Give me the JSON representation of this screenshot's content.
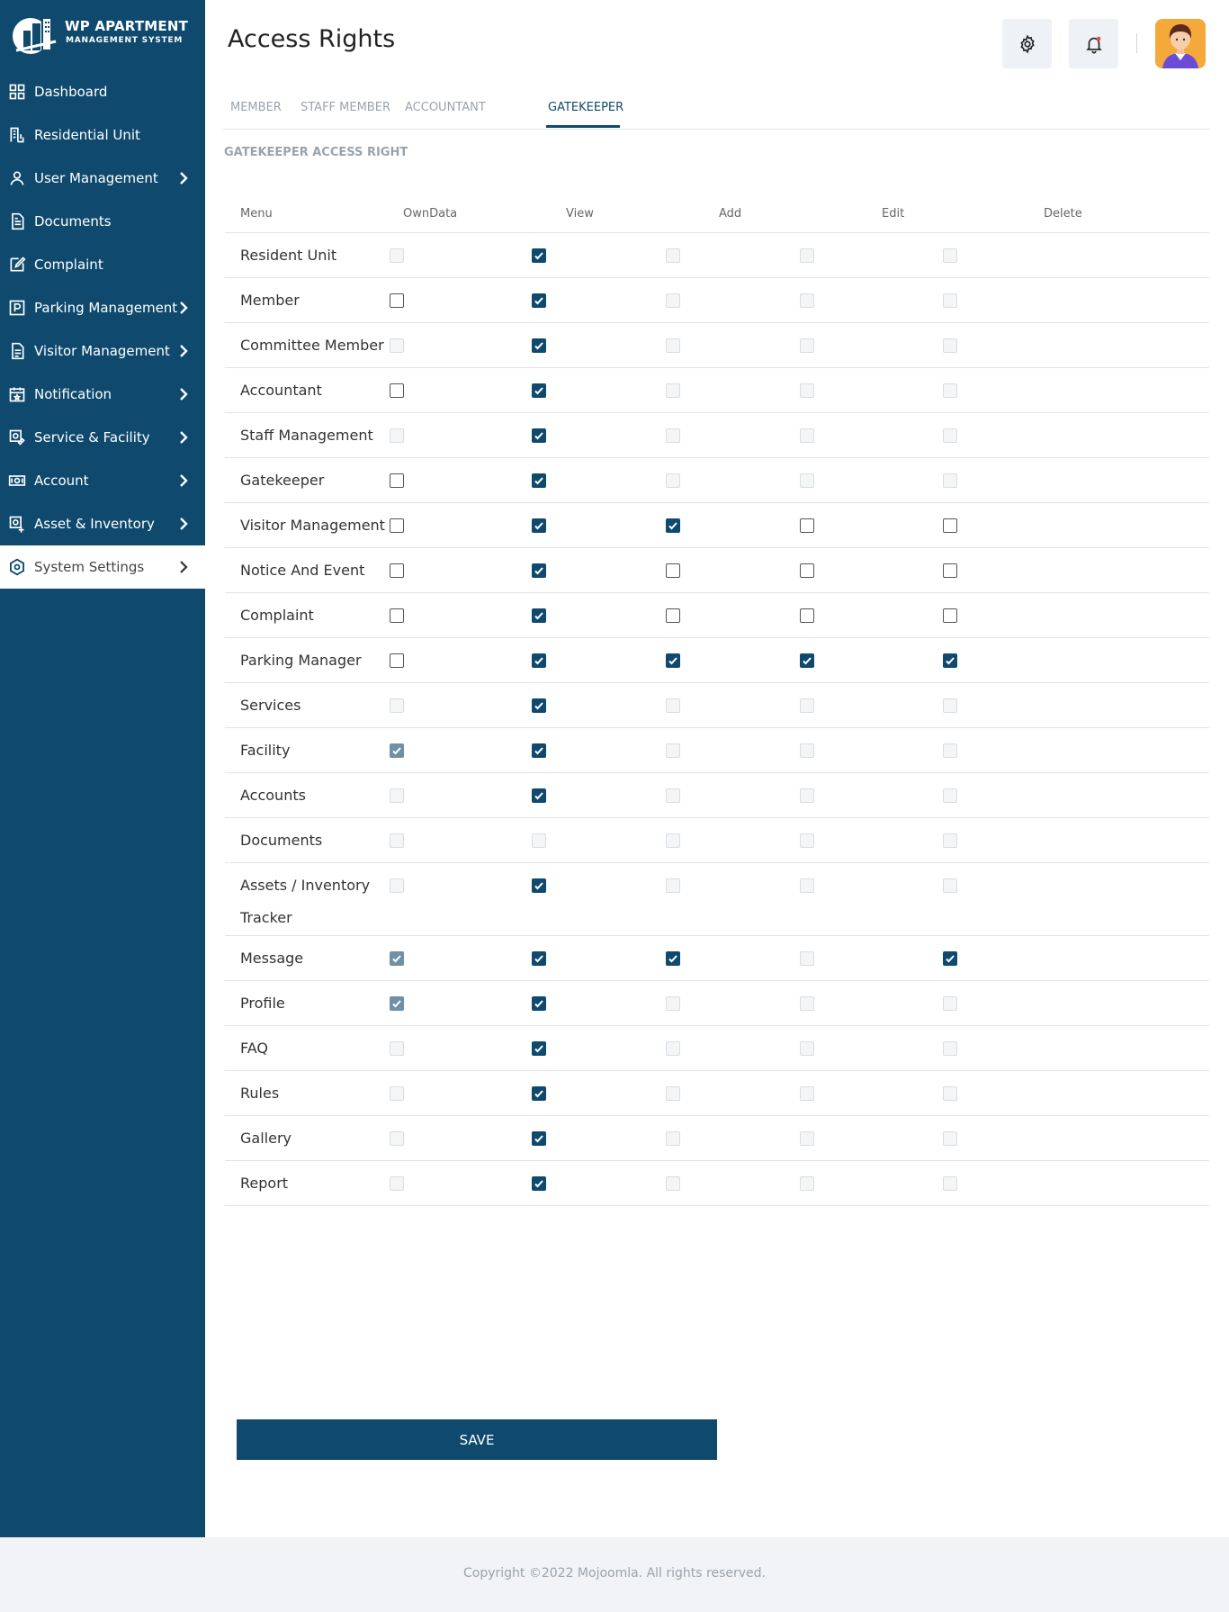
{
  "brand": {
    "title": "WP APARTMENT",
    "subtitle": "MANAGEMENT SYSTEM"
  },
  "sidebar": {
    "items": [
      {
        "label": "Dashboard",
        "icon": "dashboard-icon",
        "chevron": false
      },
      {
        "label": "Residential Unit",
        "icon": "building-icon",
        "chevron": false
      },
      {
        "label": "User Management",
        "icon": "user-icon",
        "chevron": true
      },
      {
        "label": "Documents",
        "icon": "document-icon",
        "chevron": false
      },
      {
        "label": "Complaint",
        "icon": "edit-icon",
        "chevron": false
      },
      {
        "label": "Parking Management",
        "icon": "parking-icon",
        "chevron": true
      },
      {
        "label": "Visitor Management",
        "icon": "clipboard-icon",
        "chevron": true
      },
      {
        "label": "Notification",
        "icon": "calendar-icon",
        "chevron": true
      },
      {
        "label": "Service & Facility",
        "icon": "service-icon",
        "chevron": true
      },
      {
        "label": "Account",
        "icon": "money-icon",
        "chevron": true
      },
      {
        "label": "Asset & Inventory",
        "icon": "inventory-icon",
        "chevron": true
      },
      {
        "label": "System Settings",
        "icon": "settings-icon",
        "chevron": true,
        "active": true
      }
    ]
  },
  "header": {
    "title": "Access Rights"
  },
  "tabs": [
    {
      "label": "MEMBER"
    },
    {
      "label": "STAFF MEMBER"
    },
    {
      "label": "ACCOUNTANT"
    },
    {
      "label": "GATEKEEPER",
      "active": true
    }
  ],
  "section_heading": "GATEKEEPER ACCESS RIGHT",
  "table": {
    "columns": [
      "Menu",
      "OwnData",
      "View",
      "Add",
      "Edit",
      "Delete"
    ],
    "rows": [
      {
        "label": "Resident Unit",
        "cells": [
          "dis",
          "on",
          "dis",
          "dis",
          "dis"
        ]
      },
      {
        "label": "Member",
        "cells": [
          "off",
          "on",
          "dis",
          "dis",
          "dis"
        ]
      },
      {
        "label": "Committee Member",
        "cells": [
          "dis",
          "on",
          "dis",
          "dis",
          "dis"
        ]
      },
      {
        "label": "Accountant",
        "cells": [
          "off",
          "on",
          "dis",
          "dis",
          "dis"
        ]
      },
      {
        "label": "Staff Management",
        "cells": [
          "dis",
          "on",
          "dis",
          "dis",
          "dis"
        ]
      },
      {
        "label": "Gatekeeper",
        "cells": [
          "off",
          "on",
          "dis",
          "dis",
          "dis"
        ]
      },
      {
        "label": "Visitor Management",
        "cells": [
          "off",
          "on",
          "on",
          "off",
          "off"
        ]
      },
      {
        "label": "Notice And Event",
        "cells": [
          "off",
          "on",
          "off",
          "off",
          "off"
        ]
      },
      {
        "label": "Complaint",
        "cells": [
          "off",
          "on",
          "off",
          "off",
          "off"
        ]
      },
      {
        "label": "Parking Manager",
        "cells": [
          "off",
          "on",
          "on",
          "on",
          "on"
        ]
      },
      {
        "label": "Services",
        "cells": [
          "dis",
          "on",
          "dis",
          "dis",
          "dis"
        ]
      },
      {
        "label": "Facility",
        "cells": [
          "ondis",
          "on",
          "dis",
          "dis",
          "dis"
        ]
      },
      {
        "label": "Accounts",
        "cells": [
          "dis",
          "on",
          "dis",
          "dis",
          "dis"
        ]
      },
      {
        "label": "Documents",
        "cells": [
          "dis",
          "dis",
          "dis",
          "dis",
          "dis"
        ]
      },
      {
        "label": "Assets / Inventory Tracker",
        "cells": [
          "dis",
          "on",
          "dis",
          "dis",
          "dis"
        ]
      },
      {
        "label": "Message",
        "cells": [
          "ondis",
          "on",
          "on",
          "dis",
          "on"
        ]
      },
      {
        "label": "Profile",
        "cells": [
          "ondis",
          "on",
          "dis",
          "dis",
          "dis"
        ]
      },
      {
        "label": "FAQ",
        "cells": [
          "dis",
          "on",
          "dis",
          "dis",
          "dis"
        ]
      },
      {
        "label": "Rules",
        "cells": [
          "dis",
          "on",
          "dis",
          "dis",
          "dis"
        ]
      },
      {
        "label": "Gallery",
        "cells": [
          "dis",
          "on",
          "dis",
          "dis",
          "dis"
        ]
      },
      {
        "label": "Report",
        "cells": [
          "dis",
          "on",
          "dis",
          "dis",
          "dis"
        ]
      }
    ]
  },
  "save_label": "SAVE",
  "footer": {
    "text": "Copyright ©2022 Mojoomla. All rights reserved."
  },
  "colors": {
    "primary": "#0f4a6e",
    "muted": "#9aa3ad",
    "avatar_bg": "#f6a93b"
  }
}
